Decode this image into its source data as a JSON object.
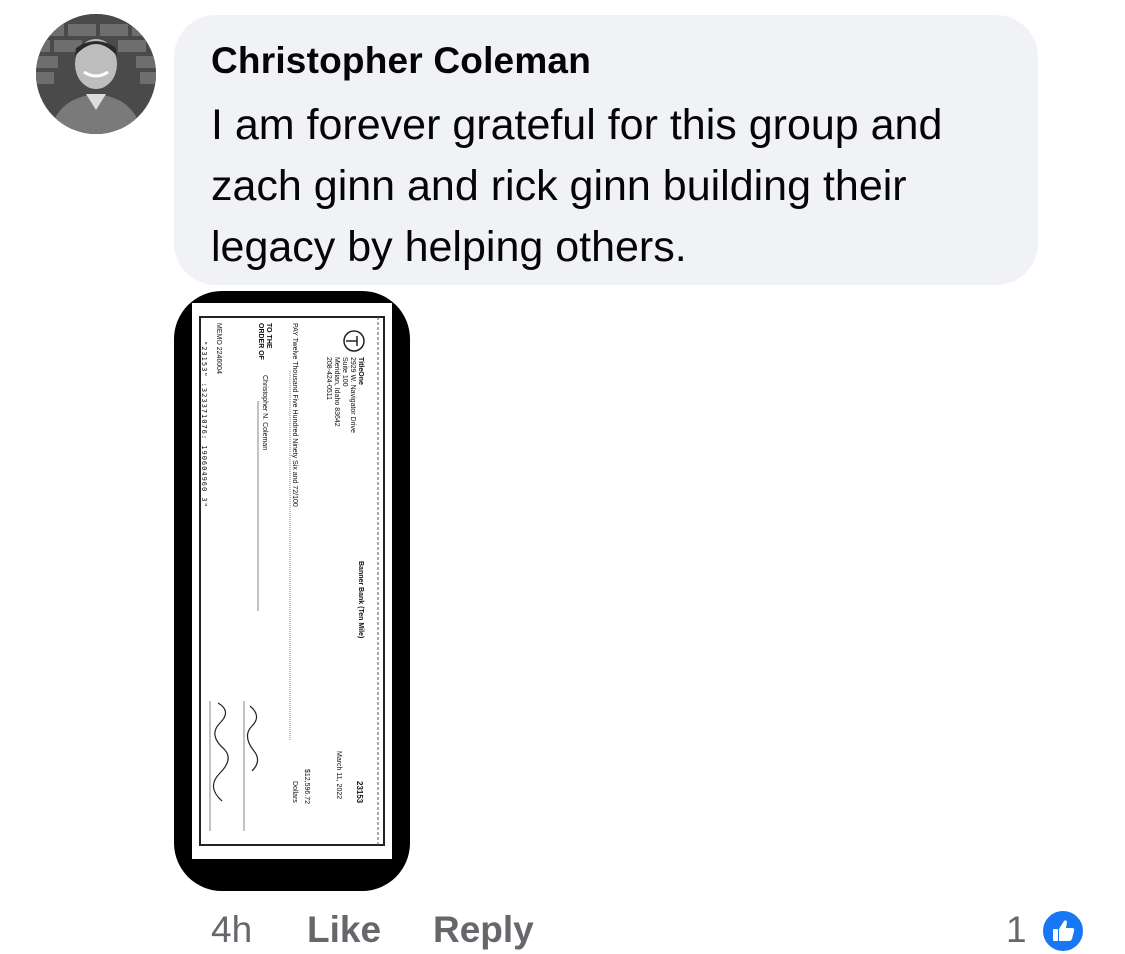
{
  "comment": {
    "author": "Christopher Coleman",
    "text": "I am forever grateful for this group and zach ginn and rick ginn building their legacy by helping others.",
    "avatar_icon": "profile-photo-avatar",
    "bubble_color": "#f0f2f5"
  },
  "attachment": {
    "check": {
      "payer_name": "TitleOne",
      "payer_address_1": "2929 W. Navigator Drive",
      "payer_address_2": "Suite 100",
      "payer_address_3": "Meridian, Idaho 83642",
      "payer_phone": "208-424-0511",
      "bank_name": "Banner Bank (Ten Mile)",
      "check_number": "23153",
      "date": "March 11, 2022",
      "amount": "$12,596.72",
      "dollars_label": "Dollars",
      "pay_line": "PAY Twelve Thousand Five Hundred Ninety Six and 72/100",
      "to_order_label": "TO THE ORDER OF",
      "payee": "Christopher N. Coleman",
      "memo": "MEMO 2246004",
      "micr": "\"23153\" :323371076: 190604960 3\""
    }
  },
  "actions": {
    "time": "4h",
    "like_label": "Like",
    "reply_label": "Reply",
    "reaction_count": "1",
    "reaction_icon": "thumbs-up-icon",
    "reaction_color": "#1877f2"
  }
}
